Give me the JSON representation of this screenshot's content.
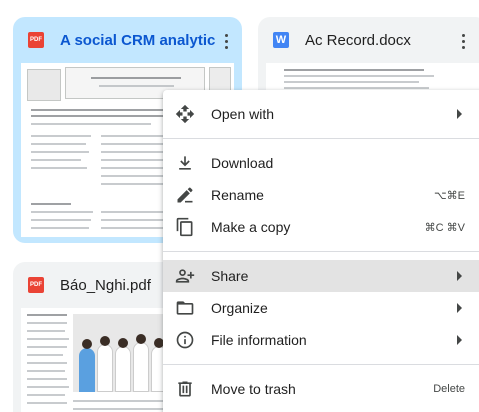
{
  "files": [
    {
      "name": "A social CRM analytic",
      "type_label": "PDF",
      "icon": "pdf-icon",
      "selected": true
    },
    {
      "name": "Ac Record.docx",
      "type_label": "W",
      "icon": "word-doc-icon",
      "selected": false
    },
    {
      "name": "Báo_Nghi.pdf",
      "type_label": "PDF",
      "icon": "pdf-icon",
      "selected": false
    }
  ],
  "menu": {
    "items": [
      {
        "label": "Open with",
        "icon": "open-with-icon",
        "has_submenu": true
      },
      {
        "label": "Download",
        "icon": "download-icon"
      },
      {
        "label": "Rename",
        "icon": "rename-icon",
        "shortcut": "⌥⌘E"
      },
      {
        "label": "Make a copy",
        "icon": "copy-icon",
        "shortcut": "⌘C ⌘V"
      },
      {
        "label": "Share",
        "icon": "share-icon",
        "has_submenu": true,
        "highlighted": true
      },
      {
        "label": "Organize",
        "icon": "organize-icon",
        "has_submenu": true
      },
      {
        "label": "File information",
        "icon": "info-icon",
        "has_submenu": true
      },
      {
        "label": "Move to trash",
        "icon": "trash-icon",
        "shortcut": "Delete"
      }
    ]
  },
  "colors": {
    "selected_card": "#c2e7ff",
    "card": "#f1f3f4",
    "pdf": "#ea4335",
    "word": "#4285f4",
    "menu_highlight": "#e3e3e3"
  }
}
